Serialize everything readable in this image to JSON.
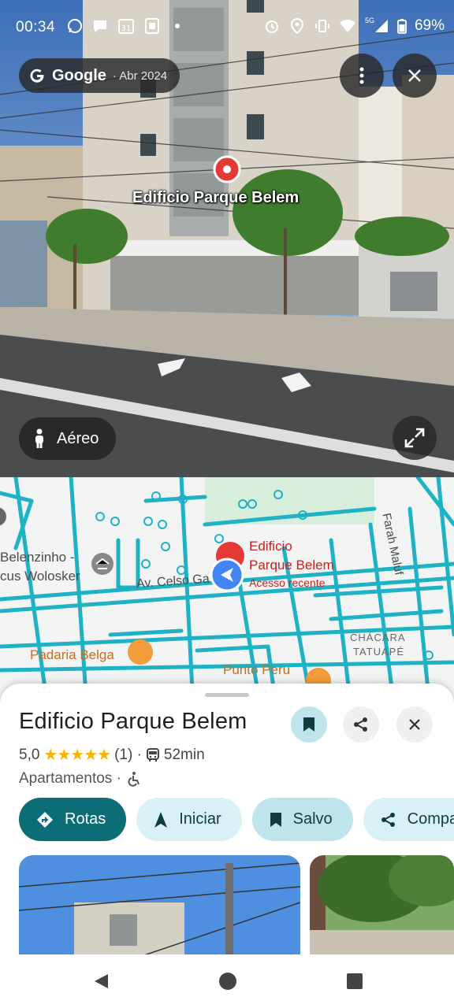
{
  "status_bar": {
    "time": "00:34",
    "calendar_day": "31",
    "network": "5G",
    "battery": "69%"
  },
  "streetview": {
    "provider": "Google",
    "date": "· Abr 2024",
    "place_label": "Edificio Parque Belem",
    "mode_button": "Aéreo"
  },
  "map": {
    "labels": {
      "belenzinho": "Belenzinho -",
      "wolosker": "cus Wolosker",
      "avenue": "Av. Celso Ga",
      "padaria": "Padaria Belga",
      "punto": "Punto Peru",
      "chacara": "CHÁCARA",
      "tatuape": "TATUAPÉ",
      "farah": "Farah Maluf",
      "place_line1": "Edificio",
      "place_line2": "Parque Belem",
      "recent": "Acesso recente"
    }
  },
  "place": {
    "title": "Edificio Parque Belem",
    "rating": "5,0",
    "stars": "★★★★★",
    "reviews": "(1) ·",
    "transit_time": "52min",
    "category": "Apartamentos ·"
  },
  "actions": {
    "directions": "Rotas",
    "start": "Iniciar",
    "saved": "Salvo",
    "share": "Compartilhar"
  },
  "colors": {
    "primary": "#0b6e77",
    "map_road": "#1fb1c4",
    "pin_red": "#e53935"
  }
}
